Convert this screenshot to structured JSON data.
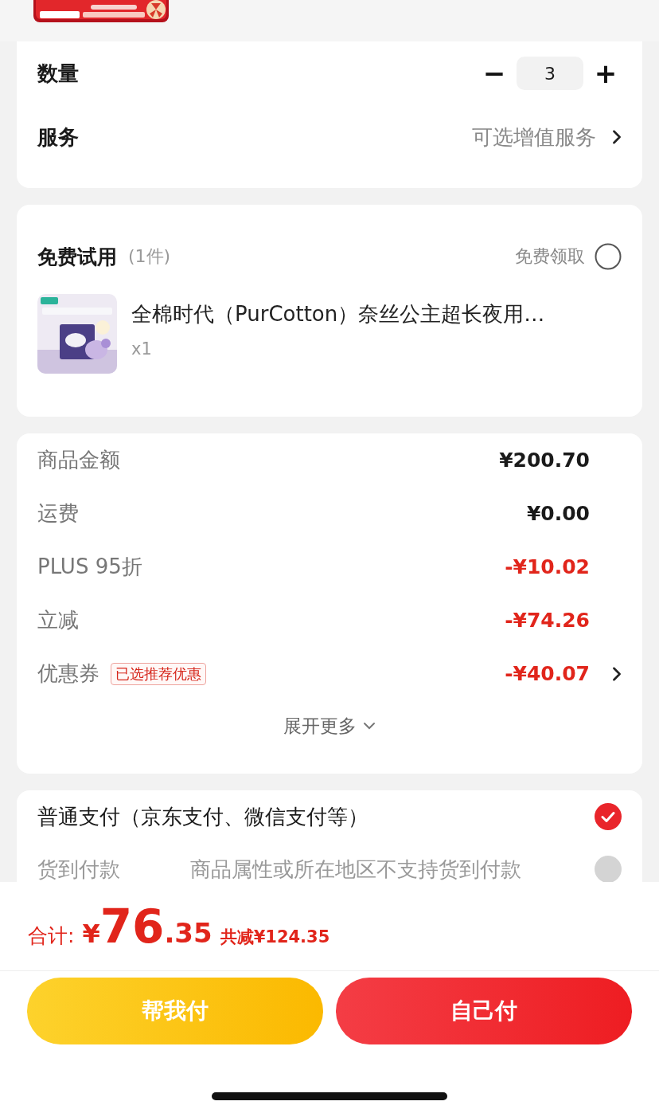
{
  "quantity": {
    "label": "数量",
    "minus": "−",
    "value": "3",
    "plus": "+"
  },
  "service": {
    "label": "服务",
    "value": "可选增值服务"
  },
  "trial": {
    "title": "免费试用",
    "count": "(1件)",
    "claim_label": "免费领取",
    "claimed": false,
    "item": {
      "name": "全棉时代（PurCotton）奈丝公主超长夜用…",
      "qty": "x1"
    }
  },
  "summary": {
    "rows": [
      {
        "label": "商品金额",
        "value": "¥200.70",
        "discount": false,
        "link": false
      },
      {
        "label": "运费",
        "value": "¥0.00",
        "discount": false,
        "link": false
      },
      {
        "label": "PLUS 95折",
        "value": "-¥10.02",
        "discount": true,
        "link": false
      },
      {
        "label": "立减",
        "value": "-¥74.26",
        "discount": true,
        "link": false
      },
      {
        "label": "优惠券",
        "tag": "已选推荐优惠",
        "value": "-¥40.07",
        "discount": true,
        "link": true
      }
    ],
    "expand": "展开更多"
  },
  "payment": [
    {
      "label": "普通支付（京东支付、微信支付等）",
      "selected": true,
      "disabled": false
    },
    {
      "label": "货到付款",
      "note": "商品属性或所在地区不支持货到付款",
      "selected": false,
      "disabled": true
    }
  ],
  "total": {
    "label": "合计:",
    "currency": "¥",
    "integer": "76",
    "decimal": ".35",
    "saved": "共减¥124.35"
  },
  "buttons": [
    {
      "label": "帮我付",
      "kind": "friend"
    },
    {
      "label": "自己付",
      "kind": "self"
    }
  ]
}
